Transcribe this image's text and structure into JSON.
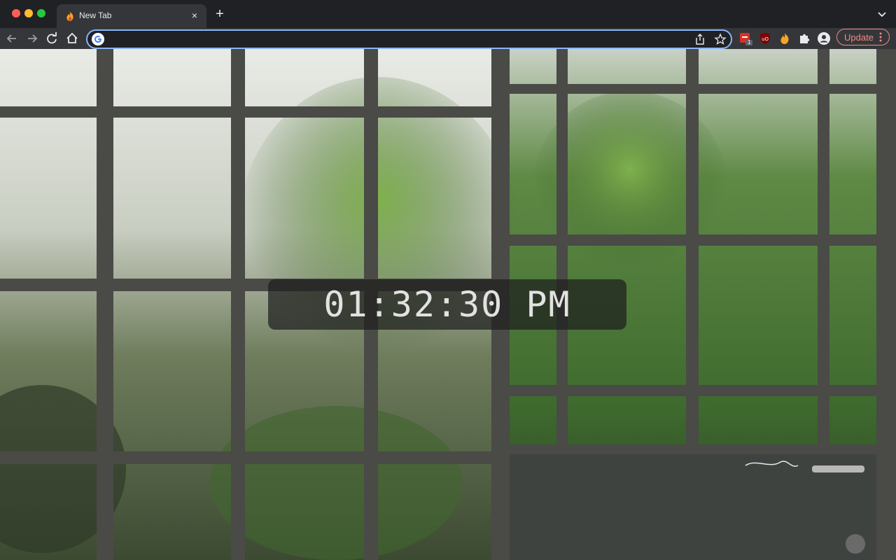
{
  "tab": {
    "title": "New Tab",
    "close_label": "×"
  },
  "newtab_label": "+",
  "omnibox": {
    "value": "",
    "placeholder": ""
  },
  "extensions": {
    "badge_count": "1"
  },
  "update_label": "Update",
  "clock": {
    "time": "01:32:30 PM"
  },
  "colors": {
    "accent": "#8ab4f8",
    "update": "#f28b82",
    "toolbar": "#35363a",
    "tabbar": "#202124"
  },
  "icons": [
    "fire-favicon-icon",
    "back-icon",
    "forward-icon",
    "reload-icon",
    "home-icon",
    "google-icon",
    "share-icon",
    "star-icon",
    "extension-red-icon",
    "ublock-icon",
    "fire-extension-icon",
    "puzzle-icon",
    "profile-icon",
    "more-vert-icon",
    "chevron-down-icon"
  ]
}
